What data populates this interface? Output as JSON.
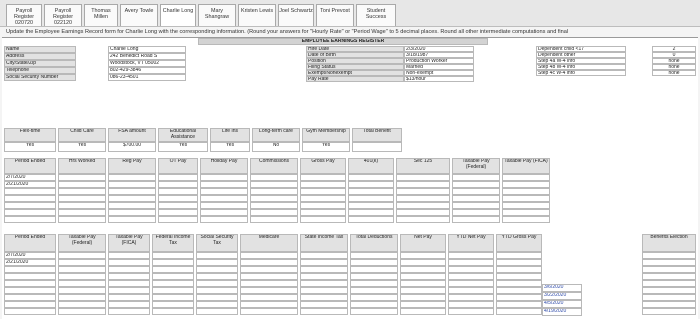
{
  "tabs": [
    "Payroll Register 020720",
    "Payroll Register 022120",
    "Thomas Millen",
    "Avery Towle",
    "Charlie Long",
    "Mary Shangraw",
    "Kristen Lewis",
    "Joel Schwartz",
    "Toni Prevost",
    "Student Success"
  ],
  "instructions": "Update the Employee Earnings Record form for Charlie Long with the corresponding information. (Round your answers for \"Hourly Rate\" or \"Period Wage\" to 5 decimal places. Round all other intermediate computations and final",
  "sheet": {
    "title": "EMPLOYEE EARNINGS REGISTER",
    "personal_labels": [
      "Name",
      "Address",
      "City/State/Zip",
      "Telephone",
      "Social Security Number"
    ],
    "personal_values": [
      "Charlie Long",
      "242 Benedict Road S",
      "Woodstock, VT 05002",
      "802-429-3846",
      "086-23-4501"
    ],
    "job_labels": [
      "Hire Date",
      "Date of Birth",
      "Position",
      "Filing Status",
      "Exempt/Nonexempt",
      "Pay Rate"
    ],
    "job_values": [
      "2/3/2020",
      "3/18/1987",
      "Production Worker",
      "Married",
      "Non-exempt",
      "$13/hour"
    ],
    "dep_labels": [
      "Dependent child <17",
      "Dependent other",
      "Step 4a W-4 info",
      "Step 4b W-4 info",
      "Step 4c W-4 info"
    ],
    "dep_values": [
      "2",
      "0",
      "none",
      "none",
      "none"
    ],
    "benefits_headers": [
      "Flex-time",
      "Child Care",
      "FSA amount",
      "Educational Assistance",
      "Life Ins",
      "Long-term care",
      "Gym Membership",
      "Total Benefit"
    ],
    "benefits_values": [
      "Yes",
      "Yes",
      "$700.00",
      "Yes",
      "Yes",
      "No",
      "Yes",
      ""
    ],
    "earn_headers": [
      "Period Ended",
      "Hrs Worked",
      "Reg Pay",
      "OT Pay",
      "Holiday Pay",
      "Commissions",
      "Gross Pay",
      "401(k)",
      "Sec 125",
      "Taxable Pay (Federal)",
      "Taxable Pay (FICA)"
    ],
    "earn_dates": [
      "2/7/2020",
      "2/21/2020"
    ],
    "ded_headers": [
      "Period Ended",
      "Taxable Pay (Federal)",
      "Taxable Pay (FICA)",
      "Federal Income Tax",
      "Social Security Tax",
      "Medicare",
      "State Income Tax",
      "Total Deductions",
      "Net Pay",
      "YTD Net Pay",
      "YTD Gross Pay",
      "Benefits Election"
    ],
    "ded_dates": [
      "2/7/2020",
      "2/21/2020"
    ],
    "footer_dates": [
      "3/6/2020",
      "3/22/2020",
      "4/5/2020",
      "4/19/2020"
    ]
  }
}
